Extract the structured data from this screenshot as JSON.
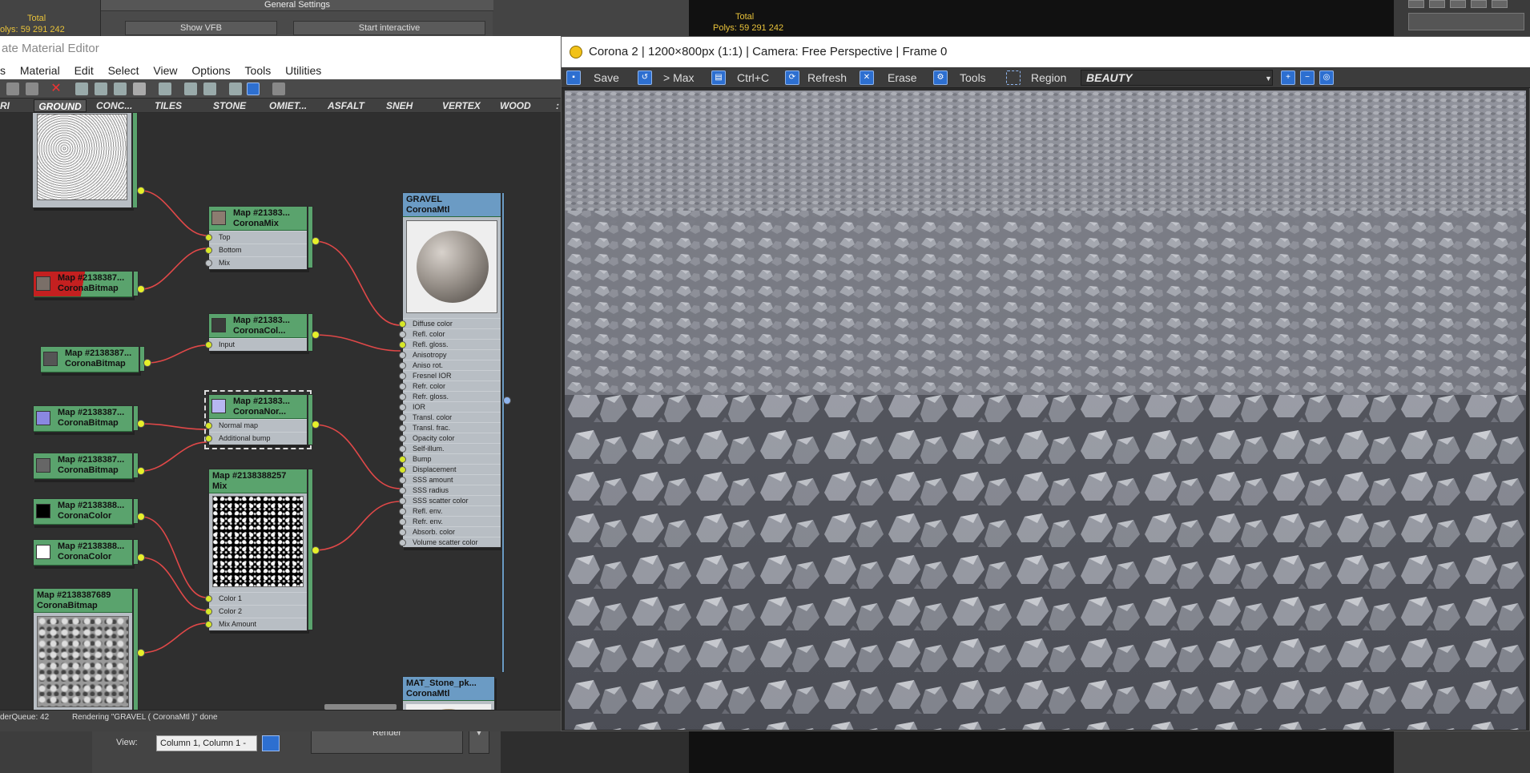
{
  "background": {
    "total_label": "Total",
    "polys_label_left": "olys:",
    "polys_value_left": "59 291 242",
    "general_settings_title": "General Settings",
    "show_vfb_button": "Show VFB",
    "start_interactive_button": "Start interactive",
    "total_label_right": "Total",
    "polys_label_right": "Polys:",
    "polys_value_right": "59 291 242",
    "view_label": "View:",
    "view_select_value": "Column 1, Column 1 -",
    "render_button": "Render",
    "arrow_button": "▼"
  },
  "slate": {
    "title": "ate Material Editor",
    "menu": [
      "s",
      "Material",
      "Edit",
      "Select",
      "View",
      "Options",
      "Tools",
      "Utilities"
    ],
    "tabs": [
      "RI",
      "GROUND",
      "CONC...",
      "TILES",
      "STONE",
      "OMIET...",
      "ASFALT",
      "SNEH",
      "VERTEX",
      "WOOD",
      ":"
    ],
    "active_tab": "GROUND",
    "status": {
      "queue": "derQueue: 42",
      "message": "Rendering \"GRAVEL  ( CoronaMtl )\" done"
    },
    "nodes": {
      "bmp_red": {
        "title": "Map #2138387...",
        "type": "CoronaBitmap"
      },
      "mix": {
        "title": "Map #21383...",
        "type": "CoronaMix",
        "slots": [
          "Top",
          "Bottom",
          "Mix"
        ]
      },
      "colcorr": {
        "title": "Map #21383...",
        "type": "CoronaCol...",
        "slots": [
          "Input"
        ]
      },
      "bmp_gray": {
        "title": "Map #2138387...",
        "type": "CoronaBitmap"
      },
      "normal": {
        "title": "Map #21383...",
        "type": "CoronaNor...",
        "slots": [
          "Normal map",
          "Additional bump"
        ]
      },
      "bmp_normal": {
        "title": "Map #2138387...",
        "type": "CoronaBitmap"
      },
      "bmp_bump": {
        "title": "Map #2138387...",
        "type": "CoronaBitmap"
      },
      "col_black": {
        "title": "Map #2138388...",
        "type": "CoronaColor"
      },
      "col_white": {
        "title": "Map #2138388...",
        "type": "CoronaColor"
      },
      "mix2": {
        "title": "Map #2138388257",
        "type": "Mix",
        "slots": [
          "Color 1",
          "Color 2",
          "Mix Amount"
        ]
      },
      "bmp_big": {
        "title": "Map #2138387689",
        "type": "CoronaBitmap"
      },
      "gravel": {
        "title": "GRAVEL",
        "type": "CoronaMtl",
        "slots": [
          "Diffuse color",
          "Refl. color",
          "Refl. gloss.",
          "Anisotropy",
          "Aniso rot.",
          "Fresnel IOR",
          "Refr. color",
          "Refr. gloss.",
          "IOR",
          "Transl. color",
          "Transl. frac.",
          "Opacity color",
          "Self-illum.",
          "Bump",
          "Displacement",
          "SSS amount",
          "SSS radius",
          "SSS scatter color",
          "Refl. env.",
          "Refr. env.",
          "Absorb. color",
          "Volume scatter color"
        ]
      },
      "stone": {
        "title": "MAT_Stone_pk...",
        "type": "CoronaMtl"
      }
    }
  },
  "vfb": {
    "title": "Corona 2 | 1200×800px (1:1) | Camera: Free Perspective | Frame 0",
    "toolbar": {
      "save": "Save",
      "to_max": "> Max",
      "copy": "Ctrl+C",
      "refresh": "Refresh",
      "erase": "Erase",
      "tools": "Tools",
      "region": "Region",
      "channel": "BEAUTY"
    }
  },
  "colors": {
    "node_green": "#5aa36d",
    "node_blue": "#6b9bc4",
    "wire_red": "#e04848",
    "slot_yellow": "#d7e728",
    "accent_blue": "#2d6fd0"
  }
}
